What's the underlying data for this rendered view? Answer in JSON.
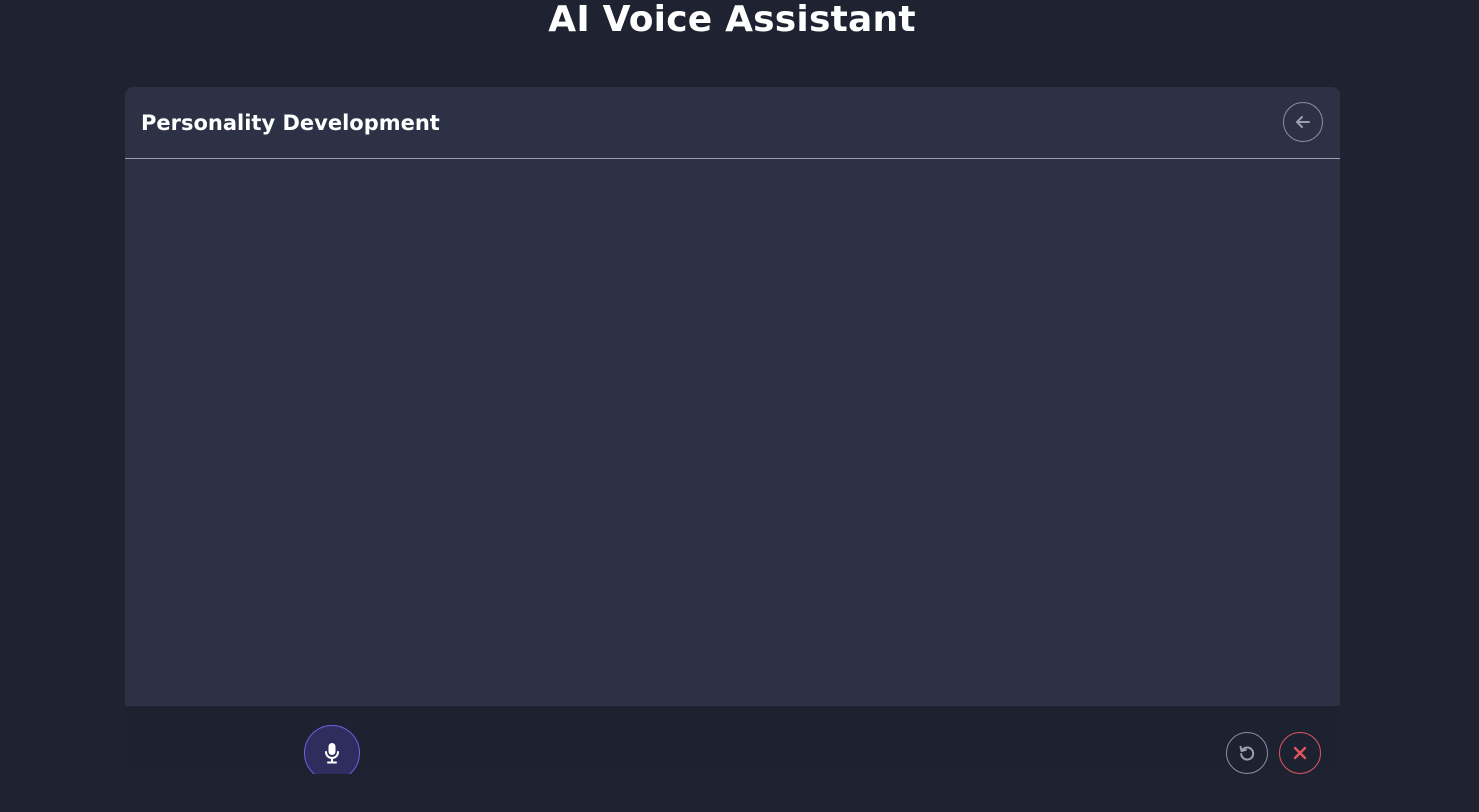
{
  "app": {
    "title": "AI Voice Assistant"
  },
  "chat": {
    "title": "Personality Development",
    "messages": []
  },
  "icons": {
    "back": "arrow-left-icon",
    "mic": "microphone-icon",
    "reset": "rotate-ccw-icon",
    "close": "x-icon"
  },
  "colors": {
    "page_background": "#1e2231",
    "card_background": "#2c3145",
    "control_bar_background": "#1d2231",
    "mic_accent": "#6e63e6",
    "close_accent": "#e0555f",
    "icon_muted": "#9aa0ad"
  }
}
